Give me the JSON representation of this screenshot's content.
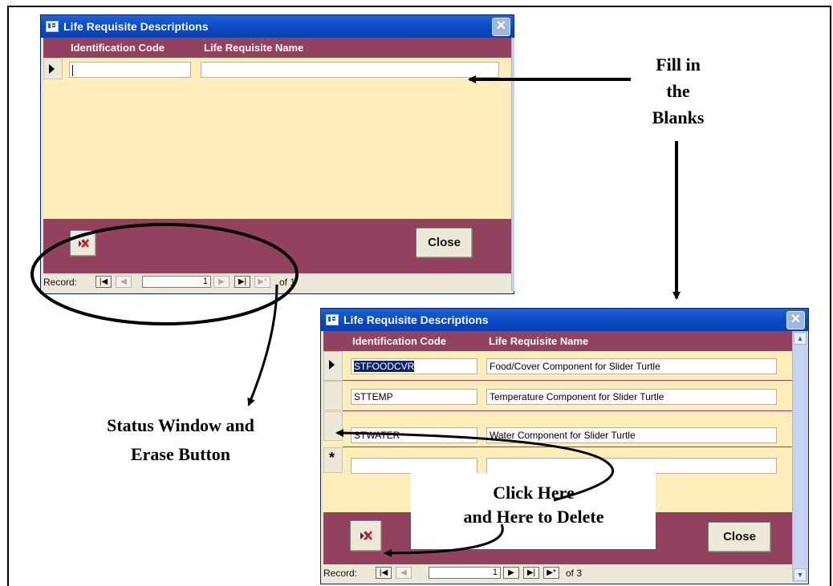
{
  "window_top": {
    "title": "Life Requisite Descriptions",
    "headers": {
      "code": "Identification Code",
      "name": "Life Requisite Name"
    },
    "close_label": "Close",
    "nav": {
      "record_label": "Record:",
      "current": "1",
      "of_text": "of 1"
    }
  },
  "window_bottom": {
    "title": "Life Requisite Descriptions",
    "headers": {
      "code": "Identification Code",
      "name": "Life Requisite Name"
    },
    "rows": [
      {
        "code": "STFOODCVR",
        "name": "Food/Cover Component for Slider Turtle"
      },
      {
        "code": "STTEMP",
        "name": "Temperature Component for Slider Turtle"
      },
      {
        "code": "STWATER",
        "name": "Water Component for Slider Turtle"
      },
      {
        "code": "",
        "name": ""
      }
    ],
    "new_record_marker": "*",
    "close_label": "Close",
    "nav": {
      "record_label": "Record:",
      "current": "1",
      "of_text": "of 3"
    }
  },
  "annotations": {
    "fill_blanks": [
      "Fill in",
      "the",
      "Blanks"
    ],
    "status_window": [
      "Status Window and",
      "Erase Button"
    ],
    "click_here": [
      "Click Here",
      "and Here to Delete"
    ]
  },
  "colors": {
    "header": "#92425e",
    "form_bg": "#ffeebb",
    "titlebar": "#0a49c2"
  }
}
